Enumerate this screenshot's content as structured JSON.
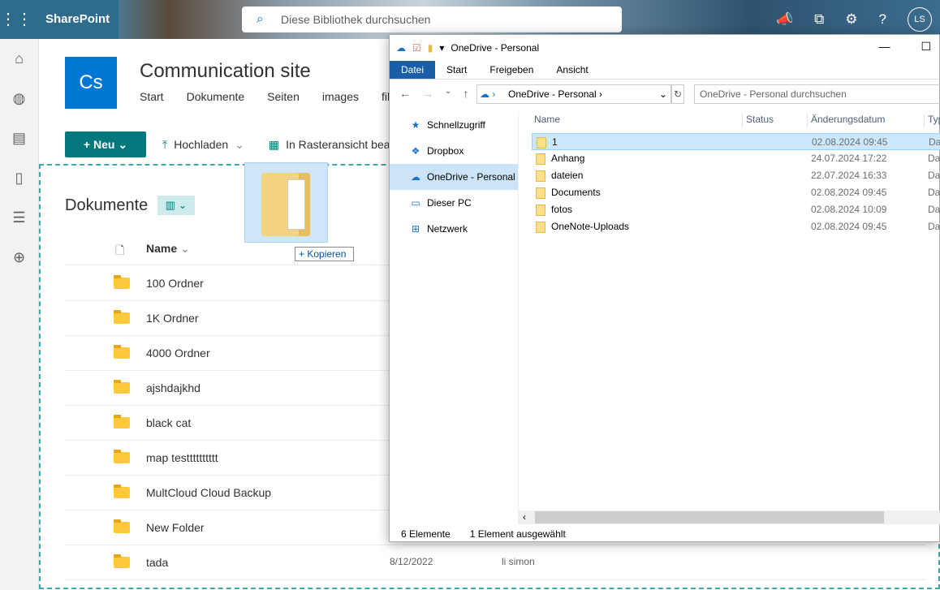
{
  "topbar": {
    "app": "SharePoint",
    "search_placeholder": "Diese Bibliothek durchsuchen",
    "avatar": "LS"
  },
  "site": {
    "logo": "Cs",
    "title": "Communication site",
    "nav": [
      "Start",
      "Dokumente",
      "Seiten",
      "images",
      "fil"
    ]
  },
  "commands": {
    "new": "+ Neu ⌄",
    "upload": "Hochladen",
    "grid": "In Rasteransicht bea"
  },
  "library": {
    "title": "Dokumente",
    "column_name": "Name",
    "rows": [
      {
        "name": "100 Ordner"
      },
      {
        "name": "1K Ordner"
      },
      {
        "name": "4000 Ordner"
      },
      {
        "name": "ajshdajkhd"
      },
      {
        "name": "black cat"
      },
      {
        "name": "map testttttttttt"
      },
      {
        "name": "MultCloud Cloud Backup"
      },
      {
        "name": "New Folder"
      },
      {
        "name": "tada",
        "date": "8/12/2022",
        "by": "li simon"
      }
    ]
  },
  "drag": {
    "badge": "+ Kopieren"
  },
  "explorer": {
    "title": "OneDrive - Personal",
    "ribbon": [
      "Datei",
      "Start",
      "Freigeben",
      "Ansicht"
    ],
    "address": "OneDrive - Personal",
    "search_placeholder": "OneDrive - Personal durchsuchen",
    "nav": [
      "Schnellzugriff",
      "Dropbox",
      "OneDrive - Personal",
      "Dieser PC",
      "Netzwerk"
    ],
    "columns": [
      "Name",
      "Status",
      "Änderungsdatum",
      "Typ"
    ],
    "files": [
      {
        "name": "1",
        "date": "02.08.2024 09:45",
        "type": "Dat"
      },
      {
        "name": "Anhang",
        "date": "24.07.2024 17:22",
        "type": "Dat"
      },
      {
        "name": "dateien",
        "date": "22.07.2024 16:33",
        "type": "Dat"
      },
      {
        "name": "Documents",
        "date": "02.08.2024 09:45",
        "type": "Dat"
      },
      {
        "name": "fotos",
        "date": "02.08.2024 10:09",
        "type": "Dat"
      },
      {
        "name": "OneNote-Uploads",
        "date": "02.08.2024 09:45",
        "type": "Dat"
      }
    ],
    "status": {
      "count": "6 Elemente",
      "selected": "1 Element ausgewählt"
    }
  }
}
